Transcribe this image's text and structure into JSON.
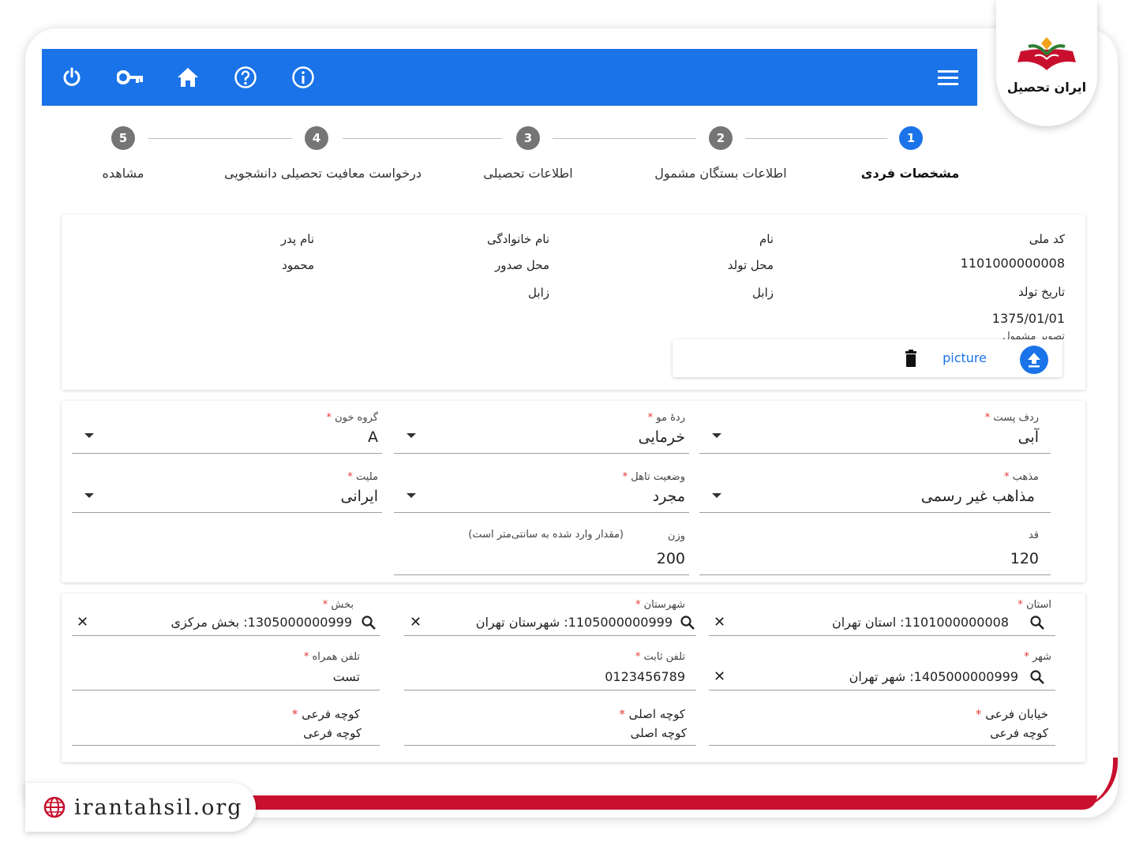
{
  "brand": {
    "logo_text": "ایران تحصیل",
    "site": "irantahsil.org",
    "accent": "#1a73e8",
    "red": "#c8102e"
  },
  "toolbar": {
    "icons": [
      "power-icon",
      "key-icon",
      "home-icon",
      "help-icon",
      "info-icon",
      "menu-icon"
    ]
  },
  "stepper": {
    "steps": [
      {
        "num": "1",
        "label": "مشخصات فردی",
        "active": true
      },
      {
        "num": "2",
        "label": "اطلاعات بستگان مشمول"
      },
      {
        "num": "3",
        "label": "اطلاعات تحصیلی"
      },
      {
        "num": "4",
        "label": "درخواست معافیت تحصیلی دانشجویی"
      },
      {
        "num": "5",
        "label": "مشاهده"
      }
    ]
  },
  "personal": {
    "national_code_label": "کد ملی",
    "national_code": "1101000000008",
    "first_name_label": "نام",
    "family_name_label": "نام خانوادگی",
    "father_name_label": "نام پدر",
    "father_name": "محمود",
    "birth_place_label": "محل تولد",
    "birth_place": "زابل",
    "issue_place_label": "محل صدور",
    "issue_place": "زابل",
    "birth_date_label": "تاریخ تولد",
    "birth_date": "1375/01/01",
    "picture_label": "تصویر مشمول",
    "picture_link": "picture"
  },
  "physical": {
    "skin_label": "ردف پست",
    "skin": "آبی",
    "hair_label": "ردهٔ مو",
    "hair": "خرمایی",
    "blood_label": "گروه خون",
    "blood": "A",
    "religion_label": "مذهب",
    "religion": "مذاهب غیر رسمی",
    "marital_label": "وضعیت تاهل",
    "marital": "مجرد",
    "nationality_label": "ملیت",
    "nationality": "ایرانی",
    "height_label": "قد",
    "height": "120",
    "weight_label": "وزن",
    "weight_hint": "(مقدار وارد شده به سانتی‌متر است)",
    "weight": "200"
  },
  "address": {
    "province_label": "استان",
    "province": "1101000000008: استان تهران",
    "county_label": "شهرستان",
    "county": "1105000000999: شهرستان تهران",
    "district_label": "بخش",
    "district": "1305000000999: بخش مرکزی",
    "city_label": "شهر",
    "city": "1405000000999: شهر تهران",
    "phone_label": "تلفن ثابت",
    "phone": "0123456789",
    "mobile_label": "تلفن همراه",
    "mobile": "تست",
    "street_label": "خیابان فرعی",
    "street": "کوچه فرعی",
    "main_alley_label": "کوچه اصلی",
    "main_alley": "کوچه اصلی",
    "sub_alley_label": "کوچه فرعی",
    "sub_alley": "کوچه فرعی"
  },
  "required_mark": "*"
}
